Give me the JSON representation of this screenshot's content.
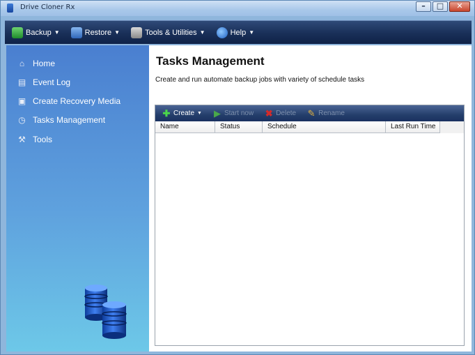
{
  "window": {
    "title": "Drive Cloner Rx"
  },
  "menubar": {
    "items": [
      {
        "label": "Backup",
        "icon": "backup-icon"
      },
      {
        "label": "Restore",
        "icon": "restore-icon"
      },
      {
        "label": "Tools & Utilities",
        "icon": "tools-icon"
      },
      {
        "label": "Help",
        "icon": "help-icon"
      }
    ]
  },
  "sidebar": {
    "items": [
      {
        "label": "Home",
        "icon": "home-icon"
      },
      {
        "label": "Event Log",
        "icon": "event-log-icon"
      },
      {
        "label": "Create Recovery Media",
        "icon": "recovery-media-icon"
      },
      {
        "label": "Tasks Management",
        "icon": "clock-icon"
      },
      {
        "label": "Tools",
        "icon": "tools-icon"
      }
    ]
  },
  "main": {
    "title": "Tasks Management",
    "description": "Create and run automate backup jobs with variety of schedule tasks",
    "toolbar": {
      "create": "Create",
      "start_now": "Start now",
      "delete": "Delete",
      "rename": "Rename"
    },
    "table": {
      "columns": [
        "Name",
        "Status",
        "Schedule",
        "Last Run Time"
      ],
      "rows": []
    }
  },
  "colors": {
    "menubar": "#192f58",
    "sidebar_top": "#4a7fd0",
    "sidebar_bottom": "#6dc8e8"
  }
}
